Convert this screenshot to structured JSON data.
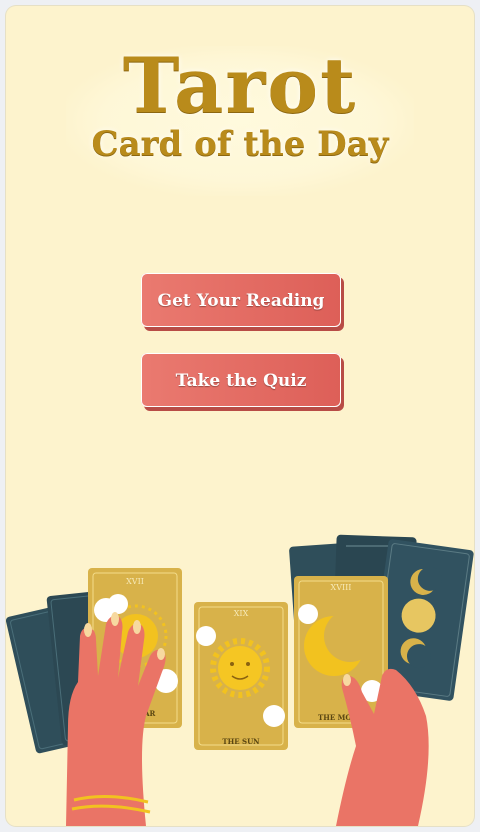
{
  "header": {
    "title": "Tarot",
    "subtitle": "Card of the Day"
  },
  "actions": {
    "reading_label": "Get Your Reading",
    "quiz_label": "Take the Quiz"
  },
  "illustration": {
    "left_card_numeral": "XVII",
    "left_card_name": "THE STAR",
    "center_card_numeral": "XIX",
    "center_card_name": "THE SUN",
    "right_card_numeral": "XVIII",
    "right_card_name": "THE MOON"
  },
  "colors": {
    "background": "#fdf3cd",
    "title_gold": "#b98b1b",
    "button": "#e36a63",
    "card_gold": "#d8b24a",
    "card_dark": "#2f4e5a",
    "hand": "#ea7466"
  }
}
